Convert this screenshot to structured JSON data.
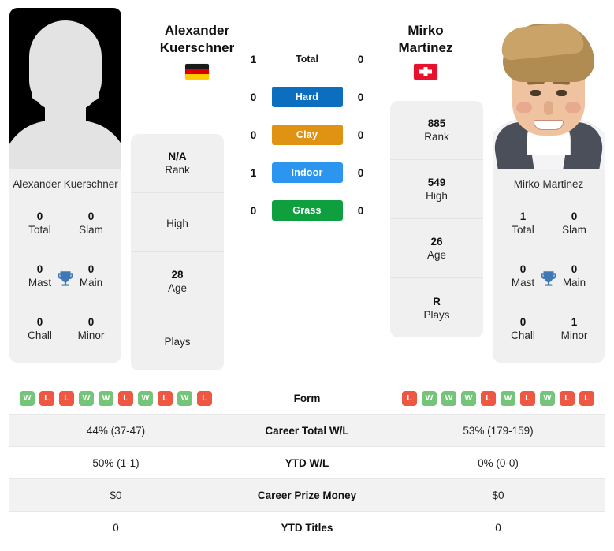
{
  "players": {
    "left": {
      "name_line1": "Alexander",
      "name_line2": "Kuerschner",
      "full_name": "Alexander Kuerschner",
      "country_flag": "germany-flag",
      "photo": "placeholder-avatar",
      "titles": [
        {
          "value": "0",
          "label": "Total"
        },
        {
          "value": "0",
          "label": "Slam"
        },
        {
          "value": "0",
          "label": "Mast"
        },
        {
          "value": "0",
          "label": "Main"
        },
        {
          "value": "0",
          "label": "Chall"
        },
        {
          "value": "0",
          "label": "Minor"
        }
      ],
      "info": [
        {
          "value": "N/A",
          "label": "Rank"
        },
        {
          "value": "",
          "label": "High"
        },
        {
          "value": "28",
          "label": "Age"
        },
        {
          "value": "",
          "label": "Plays"
        }
      ],
      "form": [
        "W",
        "L",
        "L",
        "W",
        "W",
        "L",
        "W",
        "L",
        "W",
        "L"
      ],
      "career_total_wl": "44% (37-47)",
      "ytd_wl": "50% (1-1)",
      "career_prize_money": "$0",
      "ytd_titles": "0"
    },
    "right": {
      "name_line1": "Mirko",
      "name_line2": "Martinez",
      "full_name": "Mirko Martinez",
      "country_flag": "switzerland-flag",
      "photo": "player-portrait",
      "titles": [
        {
          "value": "1",
          "label": "Total"
        },
        {
          "value": "0",
          "label": "Slam"
        },
        {
          "value": "0",
          "label": "Mast"
        },
        {
          "value": "0",
          "label": "Main"
        },
        {
          "value": "0",
          "label": "Chall"
        },
        {
          "value": "1",
          "label": "Minor"
        }
      ],
      "info": [
        {
          "value": "885",
          "label": "Rank"
        },
        {
          "value": "549",
          "label": "High"
        },
        {
          "value": "26",
          "label": "Age"
        },
        {
          "value": "R",
          "label": "Plays"
        }
      ],
      "form": [
        "L",
        "W",
        "W",
        "W",
        "L",
        "W",
        "L",
        "W",
        "L",
        "L"
      ],
      "career_total_wl": "53% (179-159)",
      "ytd_wl": "0% (0-0)",
      "career_prize_money": "$0",
      "ytd_titles": "0"
    }
  },
  "head_to_head": [
    {
      "label": "Total",
      "left": "1",
      "right": "0",
      "color": "",
      "pill": false
    },
    {
      "label": "Hard",
      "left": "0",
      "right": "0",
      "color": "#0b6ebe",
      "pill": true
    },
    {
      "label": "Clay",
      "left": "0",
      "right": "0",
      "color": "#e09213",
      "pill": true
    },
    {
      "label": "Indoor",
      "left": "1",
      "right": "0",
      "color": "#2b95f0",
      "pill": true
    },
    {
      "label": "Grass",
      "left": "0",
      "right": "0",
      "color": "#0f9f3f",
      "pill": true
    }
  ],
  "stats_table": {
    "rows": [
      {
        "label": "Form",
        "type": "form"
      },
      {
        "label": "Career Total W/L",
        "type": "text",
        "key": "career_total_wl"
      },
      {
        "label": "YTD W/L",
        "type": "text",
        "key": "ytd_wl"
      },
      {
        "label": "Career Prize Money",
        "type": "text",
        "key": "career_prize_money"
      },
      {
        "label": "YTD Titles",
        "type": "text",
        "key": "ytd_titles"
      }
    ]
  },
  "colors": {
    "win_badge": "#74c47a",
    "loss_badge": "#ee5843",
    "card_bg": "#f0f0f0",
    "trophy": "#4077b5"
  },
  "icons": {
    "trophy": "trophy-icon"
  }
}
